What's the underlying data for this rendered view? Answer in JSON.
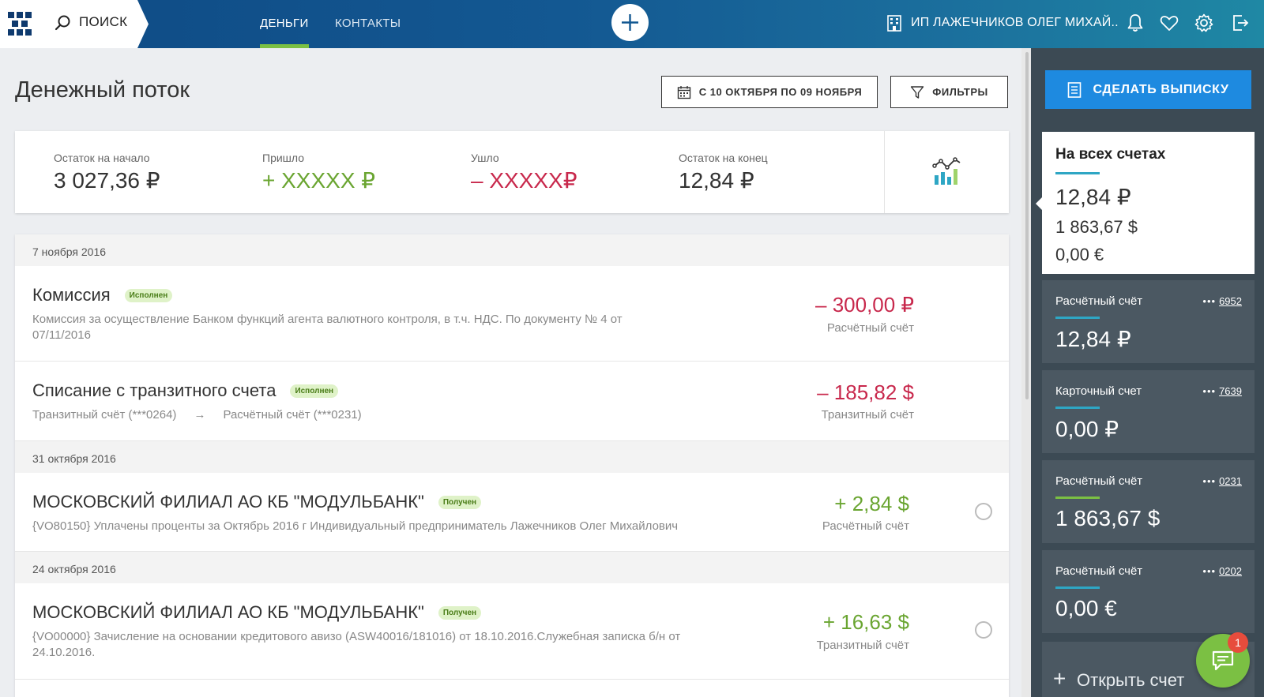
{
  "header": {
    "search_label": "ПОИСК",
    "tabs": [
      {
        "label": "ДЕНЬГИ",
        "active": true
      },
      {
        "label": "КОНТАКТЫ",
        "active": false
      }
    ],
    "org_name": "ИП ЛАЖЕЧНИКОВ ОЛЕГ МИХАЙ..",
    "icons": [
      "building-icon",
      "bell-icon",
      "heart-icon",
      "gear-icon",
      "logout-icon"
    ],
    "accent_color": "#7bc043"
  },
  "page": {
    "title": "Денежный поток",
    "date_range_label": "С 10 ОКТЯБРЯ ПО 09 НОЯБРЯ",
    "filters_label": "ФИЛЬТРЫ"
  },
  "summary": {
    "start_label": "Остаток на начало",
    "start_value": "3 027,36 ₽",
    "in_label": "Пришло",
    "in_value": "+ XXXXX ₽",
    "out_label": "Ушло",
    "out_value": "– XXXXX₽",
    "end_label": "Остаток на конец",
    "end_value": "12,84 ₽"
  },
  "groups": [
    {
      "date": "7 ноября 2016",
      "transactions": [
        {
          "title": "Комиссия",
          "status": "Исполнен",
          "description": "Комиссия за осуществление Банком функций агента валютного контроля, в т.ч. НДС. По документу № 4 от 07/11/2016",
          "amount": "– 300,00 ₽",
          "account": "Расчётный счёт"
        },
        {
          "title": "Списание с транзитного счета",
          "status": "Исполнен",
          "from": "Транзитный счёт (***0264)",
          "arrow": "→",
          "to": "Расчётный счёт (***0231)",
          "amount": "– 185,82 $",
          "account": "Транзитный счёт"
        }
      ]
    },
    {
      "date": "31 октября 2016",
      "transactions": [
        {
          "title": "МОСКОВСКИЙ ФИЛИАЛ АО КБ \"МОДУЛЬБАНК\"",
          "status": "Получен",
          "description": "{VO80150} Уплачены проценты за Октябрь 2016 г Индивидуальный предприниматель Лажечников Олег Михайлович",
          "amount": "+ 2,84 $",
          "account": "Расчётный счёт"
        }
      ]
    },
    {
      "date": "24 октября 2016",
      "transactions": [
        {
          "title": "МОСКОВСКИЙ ФИЛИАЛ АО КБ \"МОДУЛЬБАНК\"",
          "status": "Получен",
          "description": "{VO00000} Зачисление на основании кредитового авизо (ASW40016/181016) от 18.10.2016.Служебная записка б/н от 24.10.2016.",
          "amount": "+ 16,63 $",
          "account": "Транзитный счёт"
        }
      ]
    }
  ],
  "sidebar": {
    "statement_label": "СДЕЛАТЬ ВЫПИСКУ",
    "all_accounts": {
      "title": "На всех счетах",
      "balances": [
        "12,84 ₽",
        "1 863,67 $",
        "0,00 €"
      ]
    },
    "accounts": [
      {
        "name": "Расчётный счёт",
        "dots": "•••",
        "number": "6952",
        "balance": "12,84 ₽",
        "underline": "#2ea6c4"
      },
      {
        "name": "Карточный счет",
        "dots": "•••",
        "number": "7639",
        "balance": "0,00 ₽",
        "underline": "#2ea6c4"
      },
      {
        "name": "Расчётный счёт",
        "dots": "•••",
        "number": "0231",
        "balance": "1 863,67 $",
        "underline": "#7bc043"
      },
      {
        "name": "Расчётный счёт",
        "dots": "•••",
        "number": "0202",
        "balance": "0,00 €",
        "underline": "#2ea6c4"
      }
    ],
    "open_account_label": "Открыть счет",
    "chat_badge_count": "1"
  }
}
